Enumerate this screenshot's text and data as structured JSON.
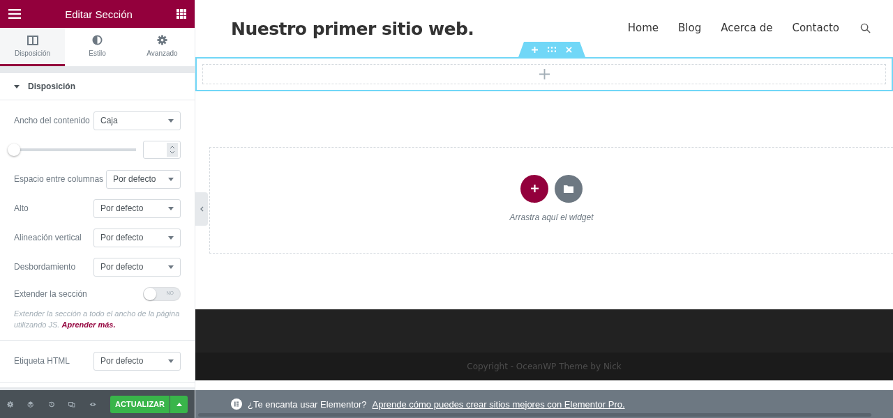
{
  "panel": {
    "title": "Editar Sección",
    "tabs": [
      {
        "label": "Disposición",
        "selected": true
      },
      {
        "label": "Estilo",
        "selected": false
      },
      {
        "label": "Avanzado",
        "selected": false
      }
    ],
    "section": {
      "title": "Disposición",
      "expanded": true,
      "groups": [
        {
          "controls": [
            {
              "kind": "select",
              "label": "Ancho del contenido",
              "value": "Caja"
            },
            {
              "kind": "slider",
              "level": 0
            },
            {
              "kind": "select",
              "label": "Espacio entre columnas",
              "value": "Por defecto"
            },
            {
              "kind": "select",
              "label": "Alto",
              "value": "Por defecto"
            },
            {
              "kind": "select",
              "label": "Alineación vertical",
              "value": "Por defecto"
            },
            {
              "kind": "select",
              "label": "Desbordamiento",
              "value": "Por defecto"
            },
            {
              "kind": "switch",
              "label": "Extender la sección",
              "on": false,
              "state_text": "NO"
            },
            {
              "kind": "help",
              "text": "Extender la sección a todo el ancho de la página utilizando JS.",
              "link": "Aprender más."
            }
          ]
        },
        {
          "controls": [
            {
              "kind": "select",
              "label": "Etiqueta HTML",
              "value": "Por defecto"
            }
          ]
        }
      ]
    },
    "toolbar": {
      "update_button": "ACTUALIZAR"
    }
  },
  "site": {
    "title": "Nuestro primer sitio web.",
    "nav": [
      {
        "label": "Home"
      },
      {
        "label": "Blog"
      },
      {
        "label": "Acerca de"
      },
      {
        "label": "Contacto"
      }
    ],
    "drop_zone": {
      "hint": "Arrastra aquí el widget"
    },
    "footer": {
      "copyright": "Copyright - OceanWP Theme by Nick"
    }
  },
  "promo": {
    "text": "¿Te encanta usar Elementor?",
    "link": "Aprende cómo puedes crear sitios mejores con Elementor Pro."
  }
}
